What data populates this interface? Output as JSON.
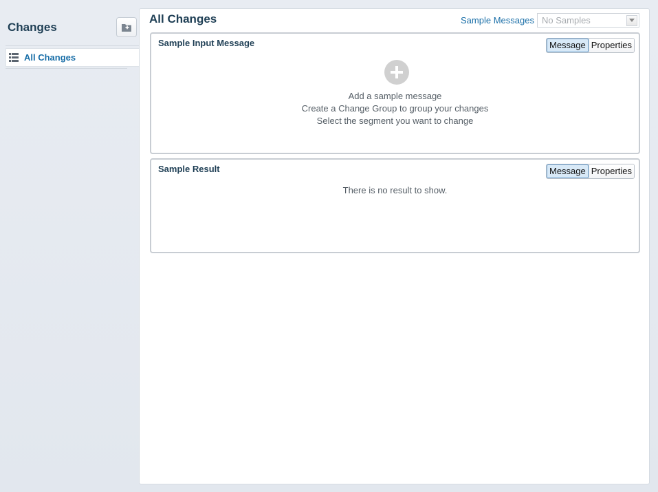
{
  "sidebar": {
    "title": "Changes",
    "add_folder_icon": "folder-add-icon",
    "items": [
      {
        "label": "All Changes",
        "icon": "list-icon"
      }
    ]
  },
  "main": {
    "title": "All Changes",
    "sample_messages_label": "Sample Messages",
    "sample_messages_select": {
      "value": "No Samples"
    },
    "input_panel": {
      "title": "Sample Input Message",
      "toggle": {
        "options": [
          "Message",
          "Properties"
        ],
        "selected": "Message"
      },
      "add_icon": "plus-circle-icon",
      "hints": [
        "Add a sample message",
        "Create a Change Group to group your changes",
        "Select the segment you want to change"
      ]
    },
    "result_panel": {
      "title": "Sample Result",
      "toggle": {
        "options": [
          "Message",
          "Properties"
        ],
        "selected": "Message"
      },
      "empty_text": "There is no result to show."
    }
  },
  "colors": {
    "accent": "#1a6fa8",
    "heading": "#1f3f55",
    "background": "#e4e8ee"
  }
}
